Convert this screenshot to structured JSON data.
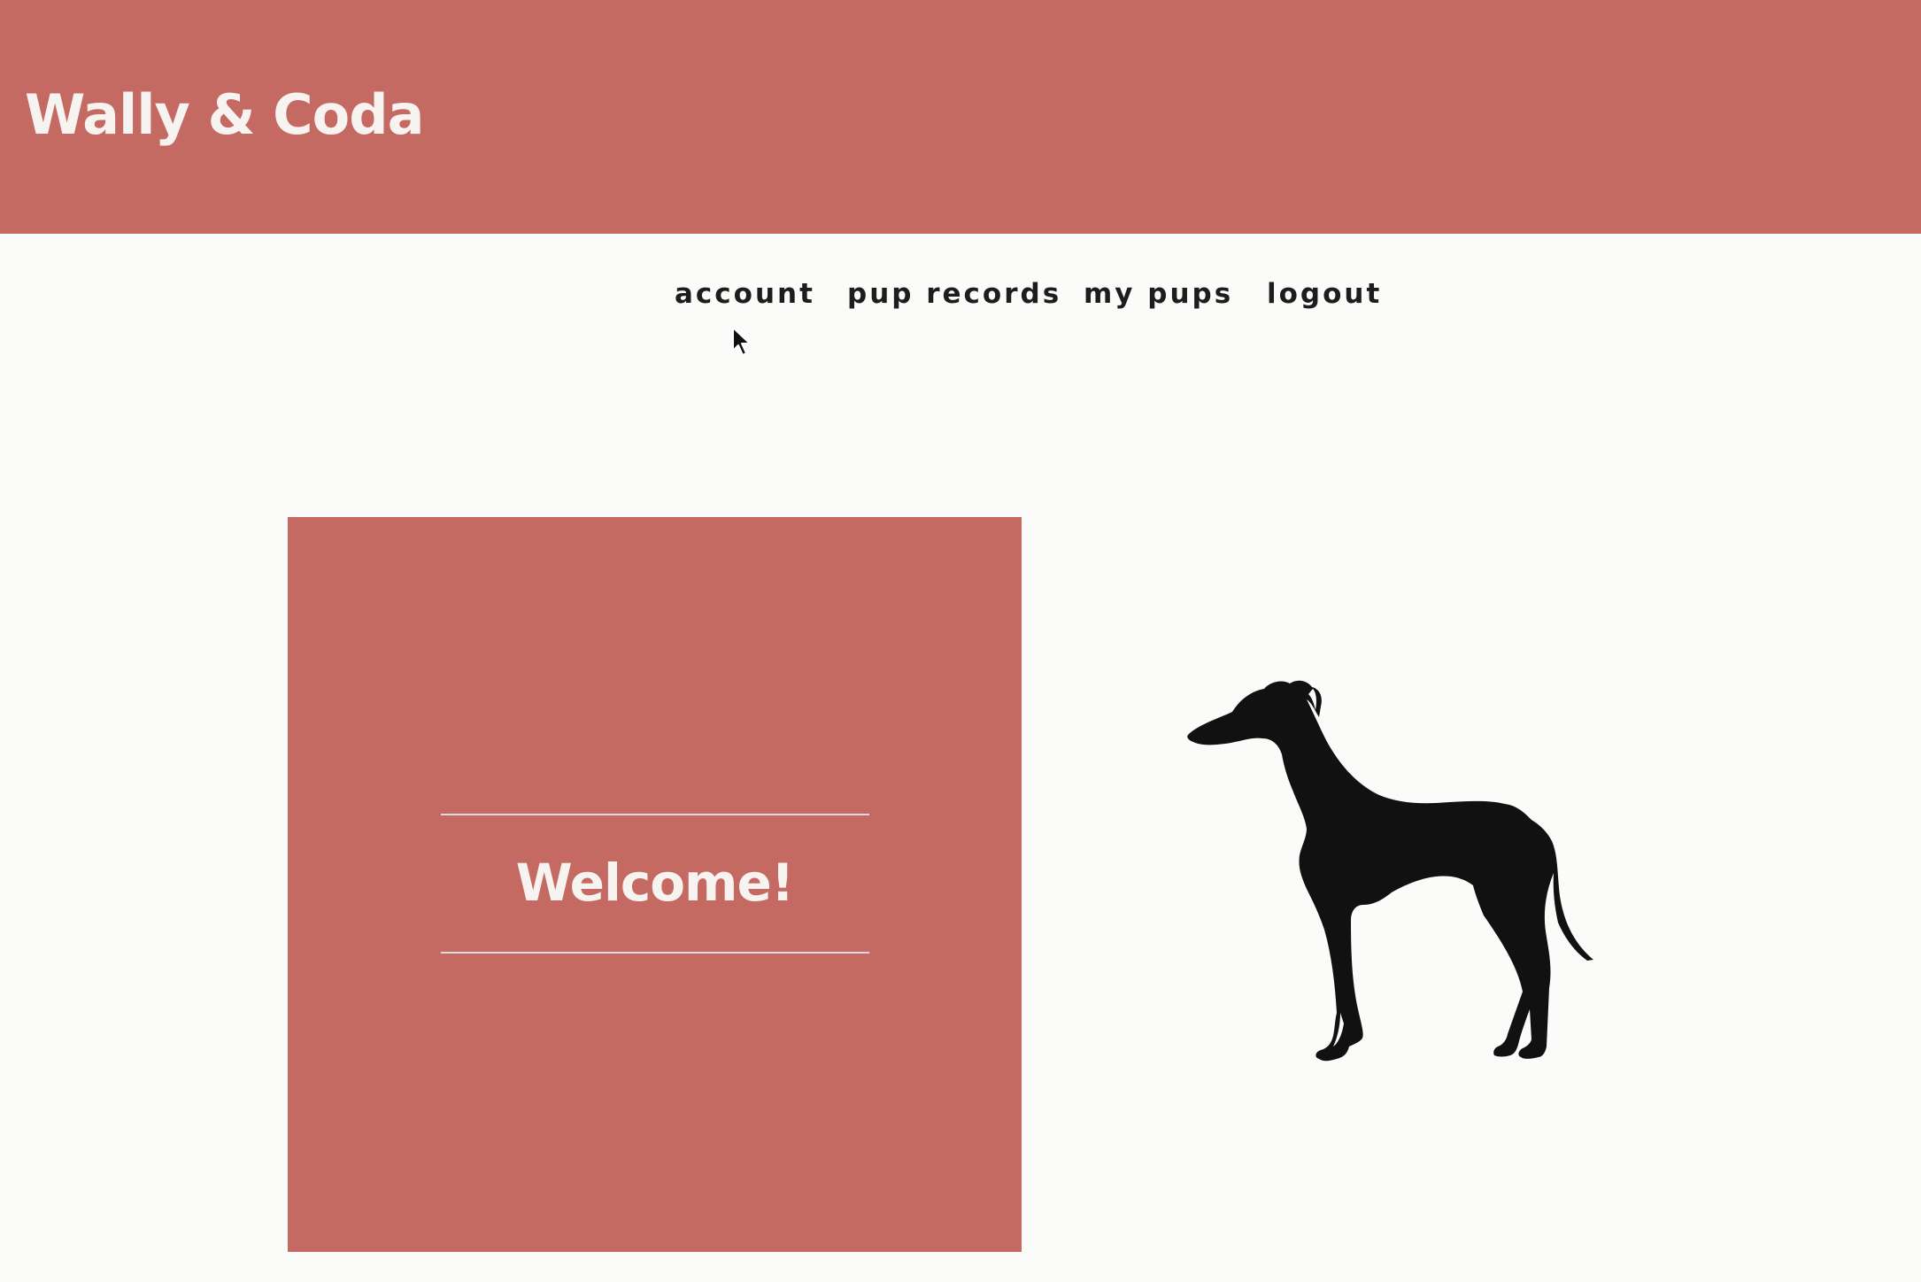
{
  "header": {
    "site_title": "Wally & Coda",
    "background_color": "#c46a63",
    "text_color": "#f6f3f1"
  },
  "nav": {
    "items": [
      {
        "label": "account"
      },
      {
        "label": "pup records"
      },
      {
        "label": "my pups"
      },
      {
        "label": "logout"
      }
    ]
  },
  "main": {
    "welcome_card": {
      "text": "Welcome!",
      "background_color": "#c46a63",
      "rule_color": "#d8dde3"
    },
    "illustration": {
      "icon": "greyhound-silhouette-icon",
      "color": "#111111"
    }
  },
  "page": {
    "background_color": "#fbfbf9",
    "cursor": "arrow-cursor-icon"
  }
}
